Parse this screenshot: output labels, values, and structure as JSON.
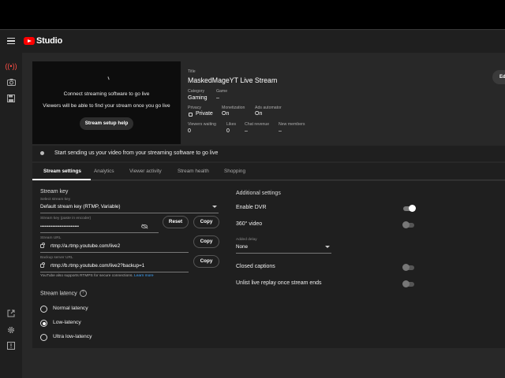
{
  "app": {
    "name": "Studio"
  },
  "preview": {
    "line1": "Connect streaming software to go live",
    "line2": "Viewers will be able to find your stream once you go live",
    "help_button": "Stream setup help"
  },
  "info": {
    "title_label": "Title",
    "title": "MaskedMageYT Live Stream",
    "category_label": "Category",
    "category": "Gaming",
    "game_label": "Game",
    "game": "–",
    "privacy_label": "Privacy",
    "privacy": "Private",
    "monetization_label": "Monetization",
    "monetization": "On",
    "ads_label": "Ads automator",
    "ads": "On",
    "viewers_label": "Viewers waiting",
    "viewers": "0",
    "likes_label": "Likes",
    "likes": "0",
    "chat_label": "Chat revenue",
    "chat": "–",
    "members_label": "New members",
    "members": "–",
    "edit_button": "Ed"
  },
  "banner": {
    "text": "Start sending us your video from your streaming software to go live"
  },
  "tabs": [
    {
      "label": "Stream settings",
      "active": true
    },
    {
      "label": "Analytics"
    },
    {
      "label": "Viewer activity"
    },
    {
      "label": "Stream health"
    },
    {
      "label": "Shopping"
    }
  ],
  "stream_key": {
    "heading": "Stream key",
    "select_label": "Select stream key",
    "select_value": "Default stream key (RTMP, Variable)",
    "key_label": "Stream key (paste in encoder)",
    "key_value": "••••••••••••••••••••••••••••",
    "reset_button": "Reset",
    "copy_button": "Copy",
    "url_label": "Stream URL",
    "url_value": "rtmp://a.rtmp.youtube.com/live2",
    "backup_label": "Backup server URL",
    "backup_value": "rtmp://b.rtmp.youtube.com/live2?backup=1",
    "rtmps_note": "YouTube also supports RTMPS for secure connections.",
    "learn_more": "Learn more"
  },
  "latency": {
    "heading": "Stream latency",
    "help": "?",
    "options": [
      {
        "label": "Normal latency",
        "selected": false
      },
      {
        "label": "Low-latency",
        "selected": true
      },
      {
        "label": "Ultra low-latency",
        "selected": false
      }
    ]
  },
  "additional": {
    "heading": "Additional settings",
    "dvr_label": "Enable DVR",
    "dvr_on": true,
    "video360_label": "360° video",
    "video360_on": false,
    "delay_label": "Added delay",
    "delay_value": "None",
    "captions_label": "Closed captions",
    "captions_on": false,
    "unlist_label": "Unlist live replay once stream ends",
    "unlist_on": false
  },
  "colors": {
    "brand_red": "#ff0000",
    "link_blue": "#3ea6ff",
    "background": "#282828",
    "panel": "#1f1f1f"
  },
  "icons": [
    "menu-icon",
    "youtube-logo-icon",
    "live-icon",
    "camera-icon",
    "save-icon",
    "external-link-icon",
    "gear-icon",
    "feedback-icon",
    "lock-icon",
    "eye-off-icon",
    "help-icon"
  ]
}
